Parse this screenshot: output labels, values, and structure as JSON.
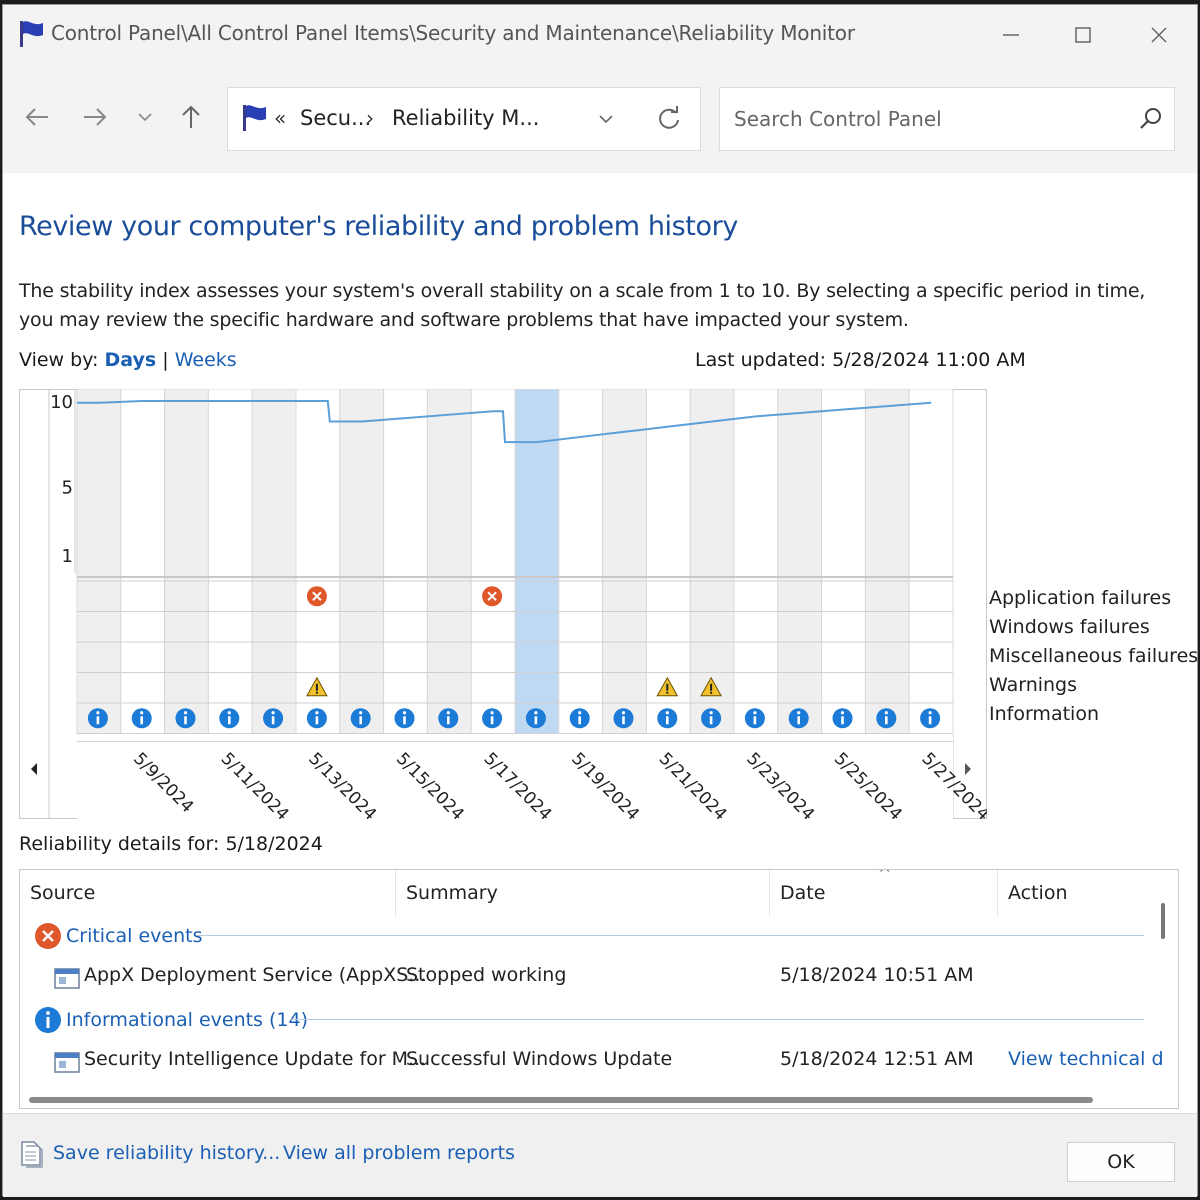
{
  "window": {
    "title": "Control Panel\\All Control Panel Items\\Security and Maintenance\\Reliability Monitor"
  },
  "address": {
    "sep0": "«",
    "crumb1": "Secu...",
    "sep1": "›",
    "crumb2": "Reliability M..."
  },
  "search": {
    "placeholder": "Search Control Panel"
  },
  "page": {
    "heading": "Review your computer's reliability and problem history",
    "description": "The stability index assesses your system's overall stability on a scale from 1 to 10. By selecting a specific period in time, you may review the specific hardware and software problems that have impacted your system.",
    "view_by_label": "View by:",
    "view_days": "Days",
    "view_sep": "|",
    "view_weeks": "Weeks",
    "last_updated": "Last updated: 5/28/2024 11:00 AM"
  },
  "chart_data": {
    "type": "line",
    "y_ticks": [
      "10",
      "5",
      "1"
    ],
    "ylim": [
      1,
      10
    ],
    "days": [
      "5/8",
      "5/9",
      "5/10",
      "5/11",
      "5/12",
      "5/13",
      "5/14",
      "5/15",
      "5/16",
      "5/17",
      "5/18",
      "5/19",
      "5/20",
      "5/21",
      "5/22",
      "5/23",
      "5/24",
      "5/25",
      "5/26",
      "5/27"
    ],
    "date_labels": [
      "5/9/2024",
      "5/11/2024",
      "5/13/2024",
      "5/15/2024",
      "5/17/2024",
      "5/19/2024",
      "5/21/2024",
      "5/23/2024",
      "5/25/2024",
      "5/27/2024"
    ],
    "selected_day": "5/18",
    "stability": [
      9.9,
      10.0,
      10.0,
      10.0,
      10.0,
      10.0,
      8.8,
      9.0,
      9.2,
      9.4,
      7.6,
      7.9,
      8.2,
      8.5,
      8.8,
      9.1,
      9.3,
      9.5,
      9.7,
      9.9
    ],
    "rows": [
      "Application failures",
      "Windows failures",
      "Miscellaneous failures",
      "Warnings",
      "Information"
    ],
    "application_failure_days": [
      "5/13",
      "5/17"
    ],
    "warning_days": [
      "5/13",
      "5/21",
      "5/22"
    ],
    "information_days": [
      "5/8",
      "5/9",
      "5/10",
      "5/11",
      "5/12",
      "5/13",
      "5/14",
      "5/15",
      "5/16",
      "5/17",
      "5/18",
      "5/19",
      "5/20",
      "5/21",
      "5/22",
      "5/23",
      "5/24",
      "5/25",
      "5/26",
      "5/27"
    ],
    "colors": {
      "line": "#5a9fd8",
      "selected": "#bfd9f2",
      "error": "#e0572a",
      "warning": "#f2c12e",
      "info": "#1b7bd6"
    }
  },
  "details": {
    "label": "Reliability details for: 5/18/2024",
    "columns": [
      "Source",
      "Summary",
      "Date",
      "Action"
    ],
    "sort_indicator": "^",
    "groups": [
      {
        "label": "Critical events"
      },
      {
        "label": "Informational events (14)"
      }
    ],
    "rows": [
      {
        "source": "AppX Deployment Service (AppXS...",
        "summary": "Stopped working",
        "date": "5/18/2024 10:51 AM",
        "action": ""
      },
      {
        "source": "Security Intelligence Update for M...",
        "summary": "Successful Windows Update",
        "date": "5/18/2024 12:51 AM",
        "action": "View technical d"
      }
    ]
  },
  "footer": {
    "save": "Save reliability history...",
    "view_all": "View all problem reports",
    "ok": "OK"
  }
}
